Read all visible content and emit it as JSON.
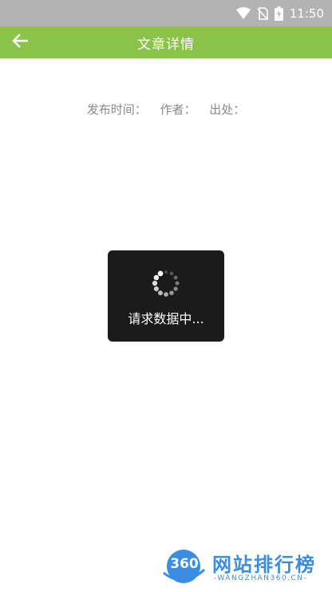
{
  "status_bar": {
    "time": "11:50",
    "icons": [
      "wifi-icon",
      "no-sim-icon",
      "battery-charging-icon"
    ]
  },
  "app_bar": {
    "title": "文章详情",
    "back_icon": "arrow-left-icon"
  },
  "article": {
    "publish_time_label": "发布时间：",
    "author_label": "作者：",
    "source_label": "出处："
  },
  "loading": {
    "text": "请求数据中..."
  },
  "watermark": {
    "badge": "360",
    "title": "网站排行榜",
    "subtitle": "-WANGZHAN360.CN-"
  },
  "colors": {
    "app_bar": "#8bc34a",
    "status_bar": "#b3b3b3",
    "dialog": "#1b1b1b",
    "meta_text": "#8a8a8a",
    "watermark": "#3a8de0"
  }
}
